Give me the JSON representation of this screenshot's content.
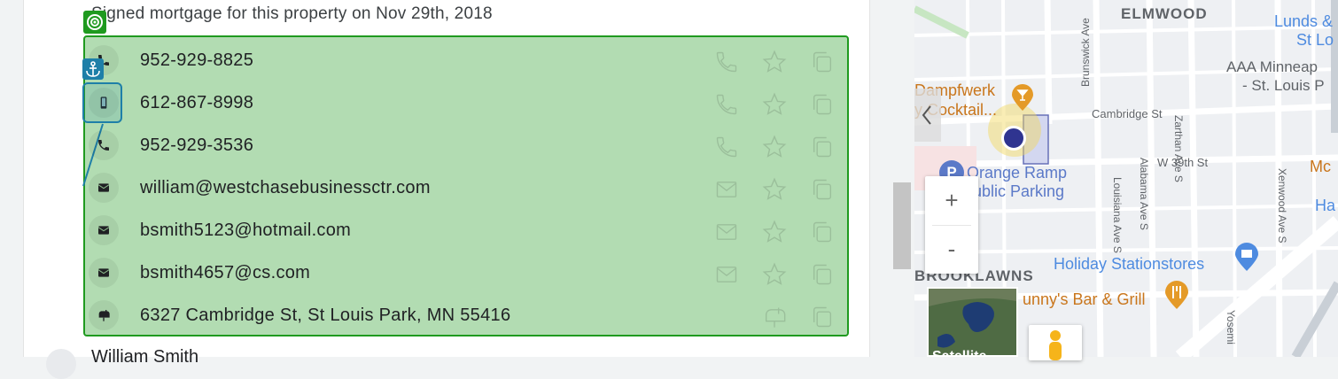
{
  "contact_card": {
    "note": "Signed mortgage for this property on Nov 29th, 2018",
    "rows": [
      {
        "type": "phone",
        "value": "952-929-8825"
      },
      {
        "type": "mobile",
        "value": "612-867-8998"
      },
      {
        "type": "phone",
        "value": "952-929-3536"
      },
      {
        "type": "email",
        "value": "william@westchasebusinessctr.com"
      },
      {
        "type": "email",
        "value": "bsmith5123@hotmail.com"
      },
      {
        "type": "email",
        "value": "bsmith4657@cs.com"
      },
      {
        "type": "mail",
        "value": "6327 Cambridge St, St Louis Park, MN 55416"
      }
    ],
    "next_contact_name": "William Smith"
  },
  "map": {
    "labels": {
      "elmwood": "ELMWOOD",
      "brunswick": "Brunswick Ave",
      "zarthan": "Zarthan Ave S",
      "lunds1": "Lunds &",
      "lunds2": "St Lo",
      "aaa1": "AAA Minneap",
      "aaa2": "- St. Louis P",
      "dampfwerk1": "Dampfwerk",
      "dampfwerk2": "y Cocktail...",
      "cambridge": "Cambridge St",
      "w39": "W 39th St",
      "orange1": "Orange Ramp",
      "orange2": "ublic Parking",
      "alabama": "Alabama Ave S",
      "louisiana": "Louisiana Ave S",
      "xenwood": "Xenwood Ave S",
      "brooklawns": "BROOKLAWNS",
      "holiday": "Holiday Stationstores",
      "sunny": "unny's Bar & Grill",
      "mc": "Mc",
      "ha": "Ha",
      "yosemite": "Yosemi"
    },
    "zoom_in": "+",
    "zoom_out": "-",
    "satellite_label": "Satellite"
  }
}
